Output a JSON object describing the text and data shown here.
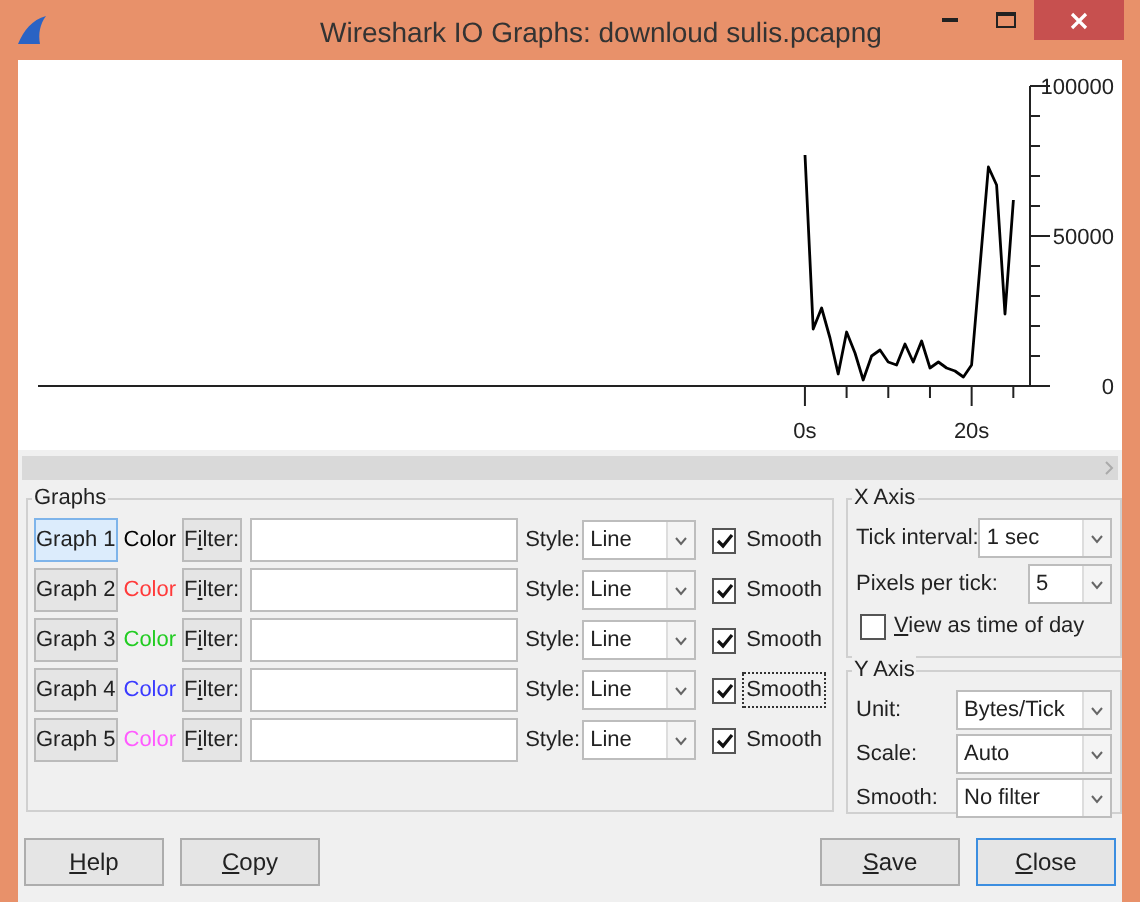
{
  "window": {
    "title": "Wireshark IO Graphs: downloud sulis.pcapng"
  },
  "chart": {
    "chart_data": {
      "type": "line",
      "x": [
        0,
        1,
        2,
        3,
        4,
        5,
        6,
        7,
        8,
        9,
        10,
        11,
        12,
        13,
        14,
        15,
        16,
        17,
        18,
        19,
        20,
        21,
        22,
        23,
        24,
        25
      ],
      "series": [
        {
          "color": "#000000",
          "values": [
            77000,
            19000,
            26000,
            16000,
            4000,
            18000,
            11000,
            2000,
            10000,
            12000,
            8000,
            7000,
            14000,
            8000,
            15000,
            6000,
            8000,
            6000,
            5000,
            3000,
            7000,
            40000,
            73000,
            67000,
            24000,
            62000
          ]
        }
      ],
      "xlim": [
        -92,
        27
      ],
      "ylim": [
        0,
        100000
      ],
      "xticks": [
        {
          "value": 0,
          "label": "0s"
        },
        {
          "value": 20,
          "label": "20s"
        }
      ],
      "yticks": [
        0,
        50000,
        100000
      ]
    }
  },
  "graphs": {
    "title": "Graphs",
    "rows": [
      {
        "button": "Graph 1",
        "selected": true,
        "color_label": "Color",
        "color": "#000000",
        "filter_button": "Filter:",
        "style_label": "Style:",
        "style": "Line",
        "smooth_label": "Smooth",
        "smooth": true,
        "focused": false
      },
      {
        "button": "Graph 2",
        "selected": false,
        "color_label": "Color",
        "color": "#ff3a3a",
        "filter_button": "Filter:",
        "style_label": "Style:",
        "style": "Line",
        "smooth_label": "Smooth",
        "smooth": true,
        "focused": false
      },
      {
        "button": "Graph 3",
        "selected": false,
        "color_label": "Color",
        "color": "#22cc22",
        "filter_button": "Filter:",
        "style_label": "Style:",
        "style": "Line",
        "smooth_label": "Smooth",
        "smooth": true,
        "focused": false
      },
      {
        "button": "Graph 4",
        "selected": false,
        "color_label": "Color",
        "color": "#3a3aff",
        "filter_button": "Filter:",
        "style_label": "Style:",
        "style": "Line",
        "smooth_label": "Smooth",
        "smooth": true,
        "focused": true
      },
      {
        "button": "Graph 5",
        "selected": false,
        "color_label": "Color",
        "color": "#ff5aff",
        "filter_button": "Filter:",
        "style_label": "Style:",
        "style": "Line",
        "smooth_label": "Smooth",
        "smooth": true,
        "focused": false
      }
    ]
  },
  "x_axis": {
    "title": "X Axis",
    "tick_interval_label": "Tick interval:",
    "tick_interval": "1 sec",
    "pixels_per_tick_label": "Pixels per tick:",
    "pixels_per_tick": "5",
    "view_as_time_label": "View as time of day",
    "view_as_time": false
  },
  "y_axis": {
    "title": "Y Axis",
    "fields": [
      {
        "label": "Unit:",
        "value": "Bytes/Tick"
      },
      {
        "label": "Scale:",
        "value": "Auto"
      },
      {
        "label": "Smooth:",
        "value": "No filter"
      }
    ]
  },
  "buttons": [
    {
      "label": "Help",
      "focused": false
    },
    {
      "label": "Copy",
      "focused": false
    },
    {
      "label": "Save",
      "focused": false
    },
    {
      "label": "Close",
      "focused": true
    }
  ]
}
